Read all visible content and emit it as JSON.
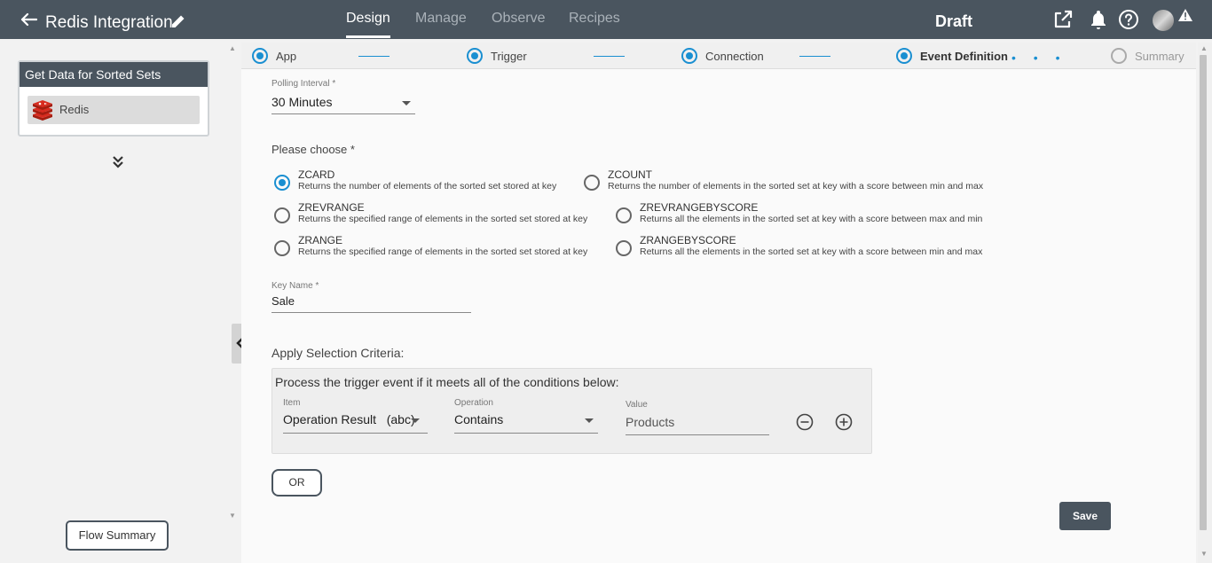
{
  "header": {
    "title": "Redis Integration",
    "tabs": [
      {
        "label": "Design",
        "active": true
      },
      {
        "label": "Manage",
        "active": false
      },
      {
        "label": "Observe",
        "active": false
      },
      {
        "label": "Recipes",
        "active": false
      }
    ],
    "status": "Draft",
    "icons": [
      "external-link-icon",
      "bell-icon",
      "help-icon",
      "avatar",
      "warning-icon"
    ]
  },
  "sidebar": {
    "card_title": "Get Data for Sorted Sets",
    "card_item": "Redis",
    "flow_summary_label": "Flow Summary"
  },
  "stepper": {
    "steps": [
      {
        "label": "App",
        "state": "done"
      },
      {
        "label": "Trigger",
        "state": "done"
      },
      {
        "label": "Connection",
        "state": "done"
      },
      {
        "label": "Event Definition",
        "state": "current"
      },
      {
        "label": "Summary",
        "state": "pending"
      }
    ]
  },
  "form": {
    "polling_label": "Polling Interval *",
    "polling_value": "30 Minutes",
    "choose_label": "Please choose *",
    "options": [
      {
        "name": "ZCARD",
        "desc": "Returns the number of elements of the sorted set stored at key",
        "selected": true
      },
      {
        "name": "ZCOUNT",
        "desc": "Returns the number of elements in the sorted set at key with a score between min and max",
        "selected": false
      },
      {
        "name": "ZREVRANGE",
        "desc": "Returns the specified range of elements in the sorted set stored at key",
        "selected": false
      },
      {
        "name": "ZREVRANGEBYSCORE",
        "desc": "Returns all the elements in the sorted set at key with a score between max and min",
        "selected": false
      },
      {
        "name": "ZRANGE",
        "desc": "Returns the specified range of elements in the sorted set stored at key",
        "selected": false
      },
      {
        "name": "ZRANGEBYSCORE",
        "desc": "Returns all the elements in the sorted set at key with a score between min and max",
        "selected": false
      }
    ],
    "key_name_label": "Key Name *",
    "key_name_value": "Sale",
    "criteria_title": "Apply Selection Criteria:",
    "criteria_text": "Process the trigger event if it meets all of the conditions below:",
    "condition": {
      "item_label": "Item",
      "item_value": "Operation Result   (abc)",
      "operation_label": "Operation",
      "operation_value": "Contains",
      "value_label": "Value",
      "value_value": "Products"
    },
    "or_label": "OR",
    "save_label": "Save"
  },
  "colors": {
    "header_bg": "#4a555f",
    "accent": "#1a8fd1",
    "redis_red": "#d82c20"
  }
}
